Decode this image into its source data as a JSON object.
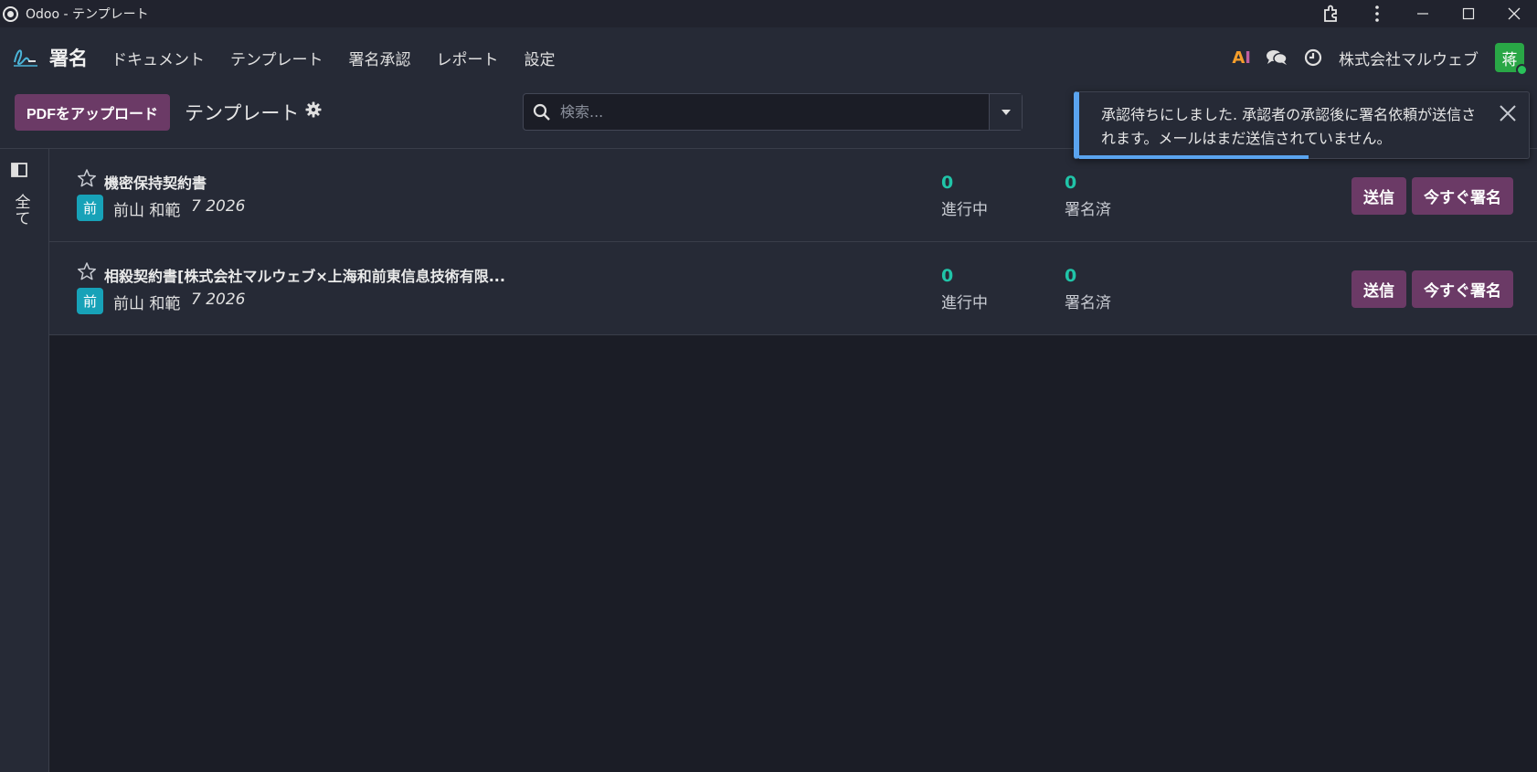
{
  "window": {
    "title": "Odoo - テンプレート"
  },
  "navbar": {
    "app_name": "署名",
    "menu": [
      "ドキュメント",
      "テンプレート",
      "署名承認",
      "レポート",
      "設定"
    ],
    "ai_label_a": "A",
    "ai_label_i": "I",
    "company": "株式会社マルウェブ",
    "avatar_initial": "蒋",
    "avatar_color": "#29a746"
  },
  "control": {
    "upload_label": "PDFをアップロード",
    "page_title": "テンプレート",
    "search_placeholder": "検索..."
  },
  "side": {
    "filter_label": "全て"
  },
  "toast": {
    "message": "承認待ちにしました. 承認者の承認後に署名依頼が送信されます。メールはまだ送信されていません。",
    "accent_color": "#5aa4ef",
    "progress": 0.51
  },
  "templates": [
    {
      "name": "機密保持契約書",
      "initial": "前",
      "owner": "前山 和範",
      "date": "7 2026",
      "in_progress_count": "0",
      "in_progress_label": "進行中",
      "signed_count": "0",
      "signed_label": "署名済",
      "send_label": "送信",
      "sign_label": "今すぐ署名"
    },
    {
      "name": "相殺契約書[株式会社マルウェブ×上海和前東信息技術有限...",
      "initial": "前",
      "owner": "前山 和範",
      "date": "7 2026",
      "in_progress_count": "0",
      "in_progress_label": "進行中",
      "signed_count": "0",
      "signed_label": "署名済",
      "send_label": "送信",
      "sign_label": "今すぐ署名"
    }
  ],
  "colors": {
    "primary_button": "#6b3a66",
    "stat_number": "#20c4a8",
    "initial_badge": "#17a2b8"
  }
}
